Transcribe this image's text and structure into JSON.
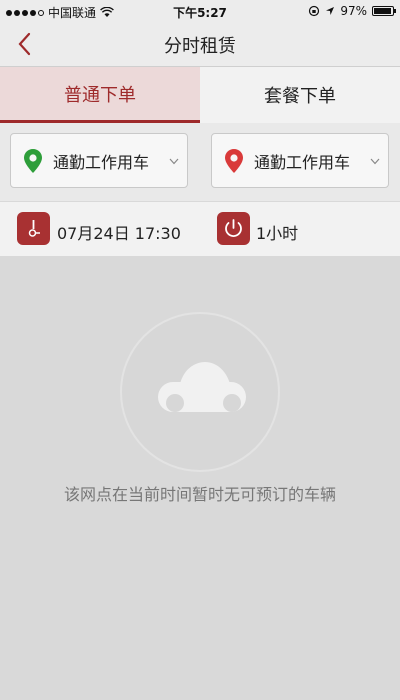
{
  "status_bar": {
    "carrier": "中国联通",
    "time": "下午5:27",
    "battery": "97%",
    "battery_level": 0.97
  },
  "nav": {
    "title": "分时租赁"
  },
  "tabs": [
    {
      "label": "普通下单",
      "active": true
    },
    {
      "label": "套餐下单",
      "active": false
    }
  ],
  "locations": {
    "pickup": {
      "label": "通勤工作用车",
      "pin_color": "#2e9e3a",
      "icon": "location-pin-icon"
    },
    "return": {
      "label": "通勤工作用车",
      "pin_color": "#d93a3a",
      "icon": "location-pin-icon"
    }
  },
  "schedule": {
    "start_time": "07月24日 17:30",
    "duration": "1小时"
  },
  "empty_state": {
    "message": "该网点在当前时间暂时无可预订的车辆"
  },
  "colors": {
    "accent": "#9e2a2b",
    "icon_bg": "#a83132"
  }
}
